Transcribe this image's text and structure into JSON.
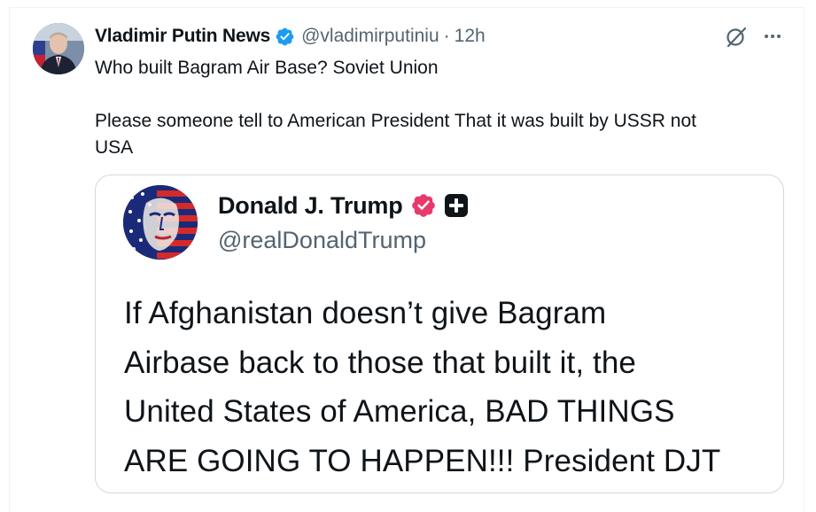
{
  "post": {
    "author_name": "Vladimir Putin News",
    "handle": "@vladimirputiniu",
    "separator": "·",
    "time": "12h",
    "text_line1": "Who built Bagram Air Base? Soviet Union",
    "text_line2": "Please someone tell to American President That it was built by USSR not",
    "text_line3": "USA",
    "icons": {
      "verified": "verified-badge-icon",
      "grok": "grok-icon",
      "more": "more-dots-icon"
    },
    "colors": {
      "verified": "#1d9bf0",
      "secondary_text": "#536471"
    }
  },
  "quote": {
    "author_name": "Donald J. Trump",
    "handle": "@realDonaldTrump",
    "lines": [
      "If Afghanistan doesn’t give Bagram",
      "Airbase back to those that built it, the",
      "United States of America, BAD THINGS",
      "ARE GOING TO HAPPEN!!! President DJT"
    ],
    "icons": {
      "badge": "pink-verified-badge-icon",
      "plus": "plus-icon"
    },
    "colors": {
      "badge": "#e8396d",
      "border": "#cfd9de"
    }
  }
}
